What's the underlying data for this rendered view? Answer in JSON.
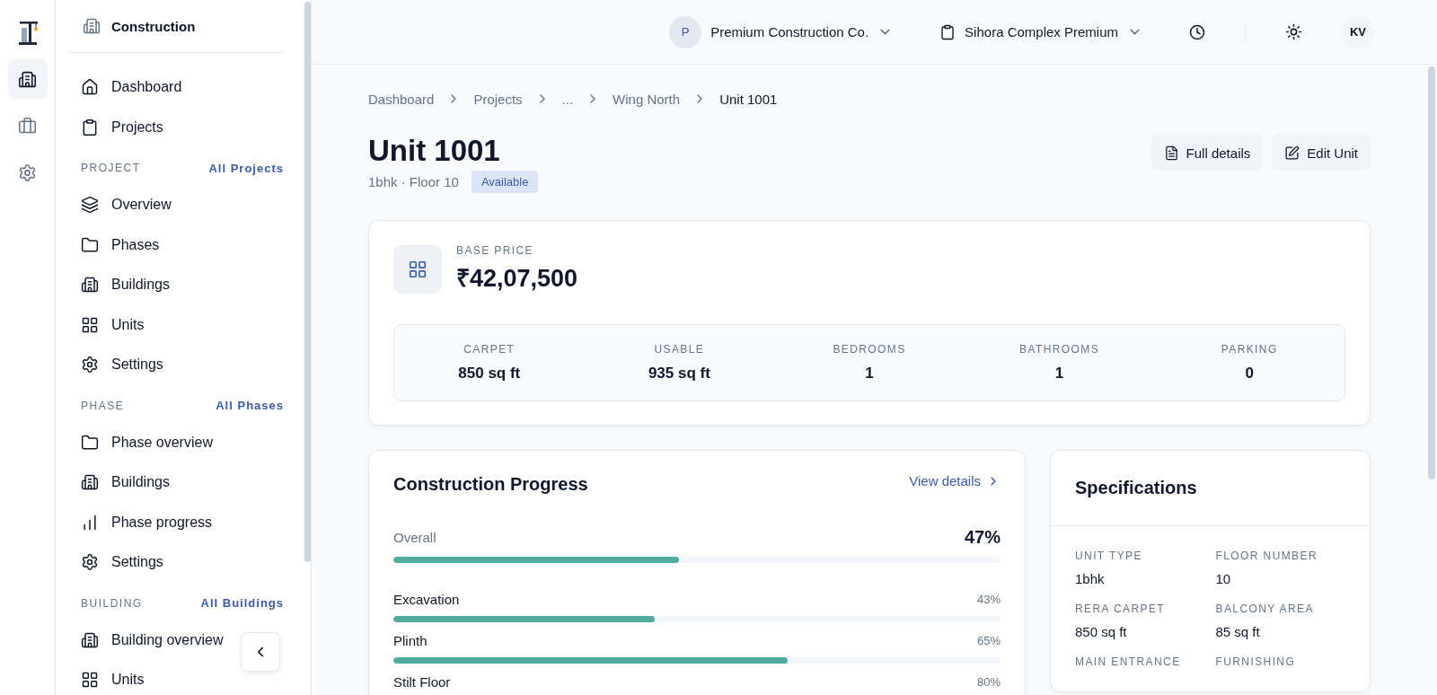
{
  "rail": [
    {
      "kind": "building",
      "selected": true
    },
    {
      "kind": "briefcase",
      "selected": false
    },
    {
      "kind": "settings",
      "selected": false
    }
  ],
  "sidebar": {
    "title": "Construction",
    "nav": [
      {
        "kind": "home",
        "label": "Dashboard"
      },
      {
        "kind": "clipboard",
        "label": "Projects"
      }
    ],
    "sections": [
      {
        "label": "PROJECT",
        "link": "All Projects",
        "items": [
          {
            "kind": "layers",
            "label": "Overview"
          },
          {
            "kind": "folder",
            "label": "Phases"
          },
          {
            "kind": "building",
            "label": "Buildings"
          },
          {
            "kind": "grid",
            "label": "Units"
          },
          {
            "kind": "settings",
            "label": "Settings"
          }
        ]
      },
      {
        "label": "PHASE",
        "link": "All Phases",
        "items": [
          {
            "kind": "folder",
            "label": "Phase overview"
          },
          {
            "kind": "building",
            "label": "Buildings"
          },
          {
            "kind": "bars",
            "label": "Phase progress"
          },
          {
            "kind": "settings",
            "label": "Settings"
          }
        ]
      },
      {
        "label": "BUILDING",
        "link": "All Buildings",
        "items": [
          {
            "kind": "building",
            "label": "Building overview"
          },
          {
            "kind": "grid",
            "label": "Units"
          }
        ]
      }
    ]
  },
  "header": {
    "company_initial": "P",
    "company": "Premium Construction Co.",
    "project": "Sihora Complex Premium",
    "dark_mode": false,
    "user_initials": "KV"
  },
  "breadcrumbs": [
    {
      "label": "Dashboard",
      "current": false
    },
    {
      "label": "Projects",
      "current": false
    },
    {
      "label": "...",
      "current": false
    },
    {
      "label": "Wing North",
      "current": false
    },
    {
      "label": "Unit 1001",
      "current": true
    }
  ],
  "unit": {
    "title": "Unit 1001",
    "subtitle": "1bhk · Floor 10",
    "status": "Available"
  },
  "actions": [
    {
      "kind": "file",
      "label": "Full details"
    },
    {
      "kind": "edit",
      "label": "Edit Unit"
    }
  ],
  "price": {
    "label": "BASE PRICE",
    "value": "₹42,07,500"
  },
  "stats": [
    {
      "label": "CARPET",
      "value": "850 sq ft"
    },
    {
      "label": "USABLE",
      "value": "935 sq ft"
    },
    {
      "label": "BEDROOMS",
      "value": "1"
    },
    {
      "label": "BATHROOMS",
      "value": "1"
    },
    {
      "label": "PARKING",
      "value": "0"
    }
  ],
  "progress": {
    "title": "Construction Progress",
    "link": "View details",
    "overall": {
      "label": "Overall",
      "reading": "47%",
      "level": 0.47
    },
    "stages": [
      {
        "label": "Excavation",
        "reading": "43%",
        "level": 0.43
      },
      {
        "label": "Plinth",
        "reading": "65%",
        "level": 0.65
      },
      {
        "label": "Stilt Floor",
        "reading": "80%"
      }
    ]
  },
  "specifications": {
    "title": "Specifications",
    "items": [
      {
        "label": "UNIT TYPE",
        "value": "1bhk"
      },
      {
        "label": "FLOOR NUMBER",
        "value": "10"
      },
      {
        "label": "RERA CARPET",
        "value": "850 sq ft"
      },
      {
        "label": "BALCONY AREA",
        "value": "85 sq ft"
      },
      {
        "label": "MAIN ENTRANCE"
      },
      {
        "label": "FURNISHING"
      }
    ]
  }
}
